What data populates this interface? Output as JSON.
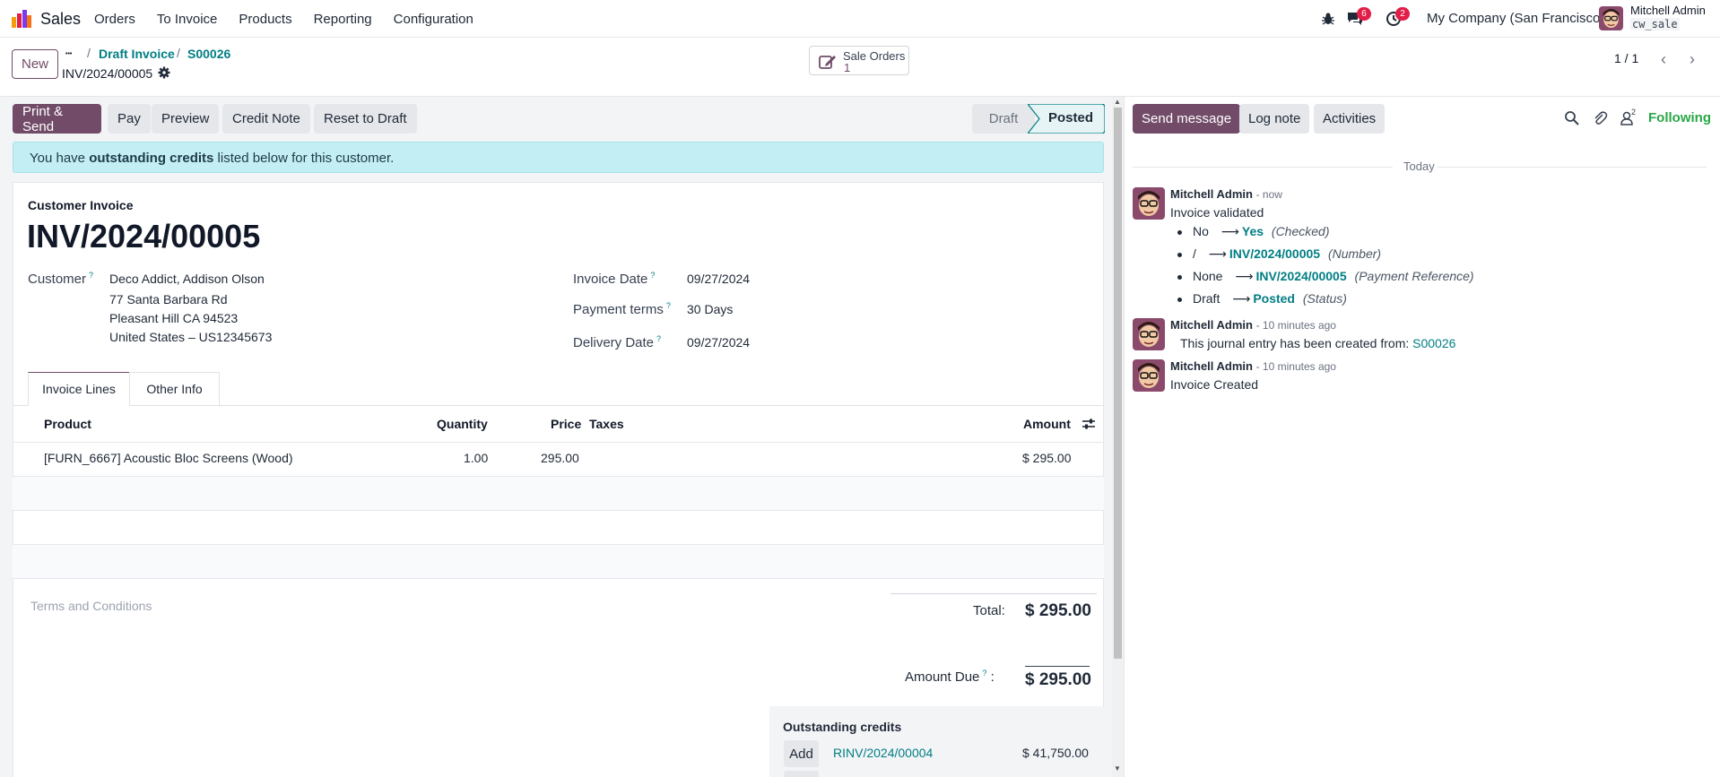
{
  "navbar": {
    "app_name": "Sales",
    "menu": [
      "Orders",
      "To Invoice",
      "Products",
      "Reporting",
      "Configuration"
    ],
    "chat_count": "6",
    "activity_count": "2",
    "company": "My Company (San Francisco)",
    "user_name": "Mitchell Admin",
    "user_db": "cw_sale"
  },
  "control_panel": {
    "new_label": "New",
    "breadcrumb_dots": "•••",
    "breadcrumb": [
      "Draft Invoice",
      "S00026"
    ],
    "record_name": "INV/2024/00005",
    "smart_button": {
      "label": "Sale Orders",
      "count": "1"
    },
    "pager": "1 / 1"
  },
  "actions": {
    "print_send": "Print & Send",
    "pay": "Pay",
    "preview": "Preview",
    "credit_note": "Credit Note",
    "reset_draft": "Reset to Draft"
  },
  "status": {
    "draft": "Draft",
    "posted": "Posted",
    "current": "Posted"
  },
  "alert": {
    "pre": "You have ",
    "bold": "outstanding credits",
    "post": " listed below for this customer."
  },
  "invoice": {
    "type_label": "Customer Invoice",
    "number": "INV/2024/00005",
    "customer_label": "Customer",
    "customer_name": "Deco Addict, Addison Olson",
    "address": [
      "77 Santa Barbara Rd",
      "Pleasant Hill CA 94523",
      "United States – US12345673"
    ],
    "invoice_date_label": "Invoice Date",
    "invoice_date": "09/27/2024",
    "payment_terms_label": "Payment terms",
    "payment_terms": "30 Days",
    "delivery_date_label": "Delivery Date",
    "delivery_date": "09/27/2024",
    "help_mark": "?"
  },
  "tabs": [
    "Invoice Lines",
    "Other Info"
  ],
  "lines": {
    "headers": {
      "product": "Product",
      "quantity": "Quantity",
      "price": "Price",
      "taxes": "Taxes",
      "amount": "Amount"
    },
    "rows": [
      {
        "product": "[FURN_6667] Acoustic Bloc Screens (Wood)",
        "quantity": "1.00",
        "price": "295.00",
        "taxes": "",
        "amount": "$ 295.00"
      }
    ]
  },
  "totals": {
    "terms_placeholder": "Terms and Conditions",
    "total_label": "Total:",
    "total_value": "$ 295.00",
    "amount_due_label": "Amount Due",
    "amount_due_colon": ":",
    "amount_due_value": "$ 295.00"
  },
  "credits": {
    "title": "Outstanding credits",
    "add_label": "Add",
    "items": [
      {
        "ref": "RINV/2024/00004",
        "amount": "$ 41,750.00"
      }
    ]
  },
  "chatter": {
    "send_message": "Send message",
    "log_note": "Log note",
    "activities": "Activities",
    "followers_count": "2",
    "following": "Following",
    "today": "Today",
    "messages": [
      {
        "author": "Mitchell Admin",
        "time": "- now",
        "body": "Invoice validated",
        "tracking": [
          {
            "old": "No",
            "new": "Yes",
            "field": "(Checked)"
          },
          {
            "old": "/",
            "new": "INV/2024/00005",
            "field": "(Number)"
          },
          {
            "old": "None",
            "new": "INV/2024/00005",
            "field": "(Payment Reference)"
          },
          {
            "old": "Draft",
            "new": "Posted",
            "field": "(Status)"
          }
        ]
      },
      {
        "author": "Mitchell Admin",
        "time": "- 10 minutes ago",
        "body": "This journal entry has been created from:",
        "link": "S00026"
      },
      {
        "author": "Mitchell Admin",
        "time": "- 10 minutes ago",
        "body": "Invoice Created"
      }
    ]
  },
  "colors": {
    "brand": "#714b67",
    "link": "#017e84",
    "alert_bg": "#c3eef3",
    "following": "#28a745",
    "badge": "#e11d48"
  }
}
